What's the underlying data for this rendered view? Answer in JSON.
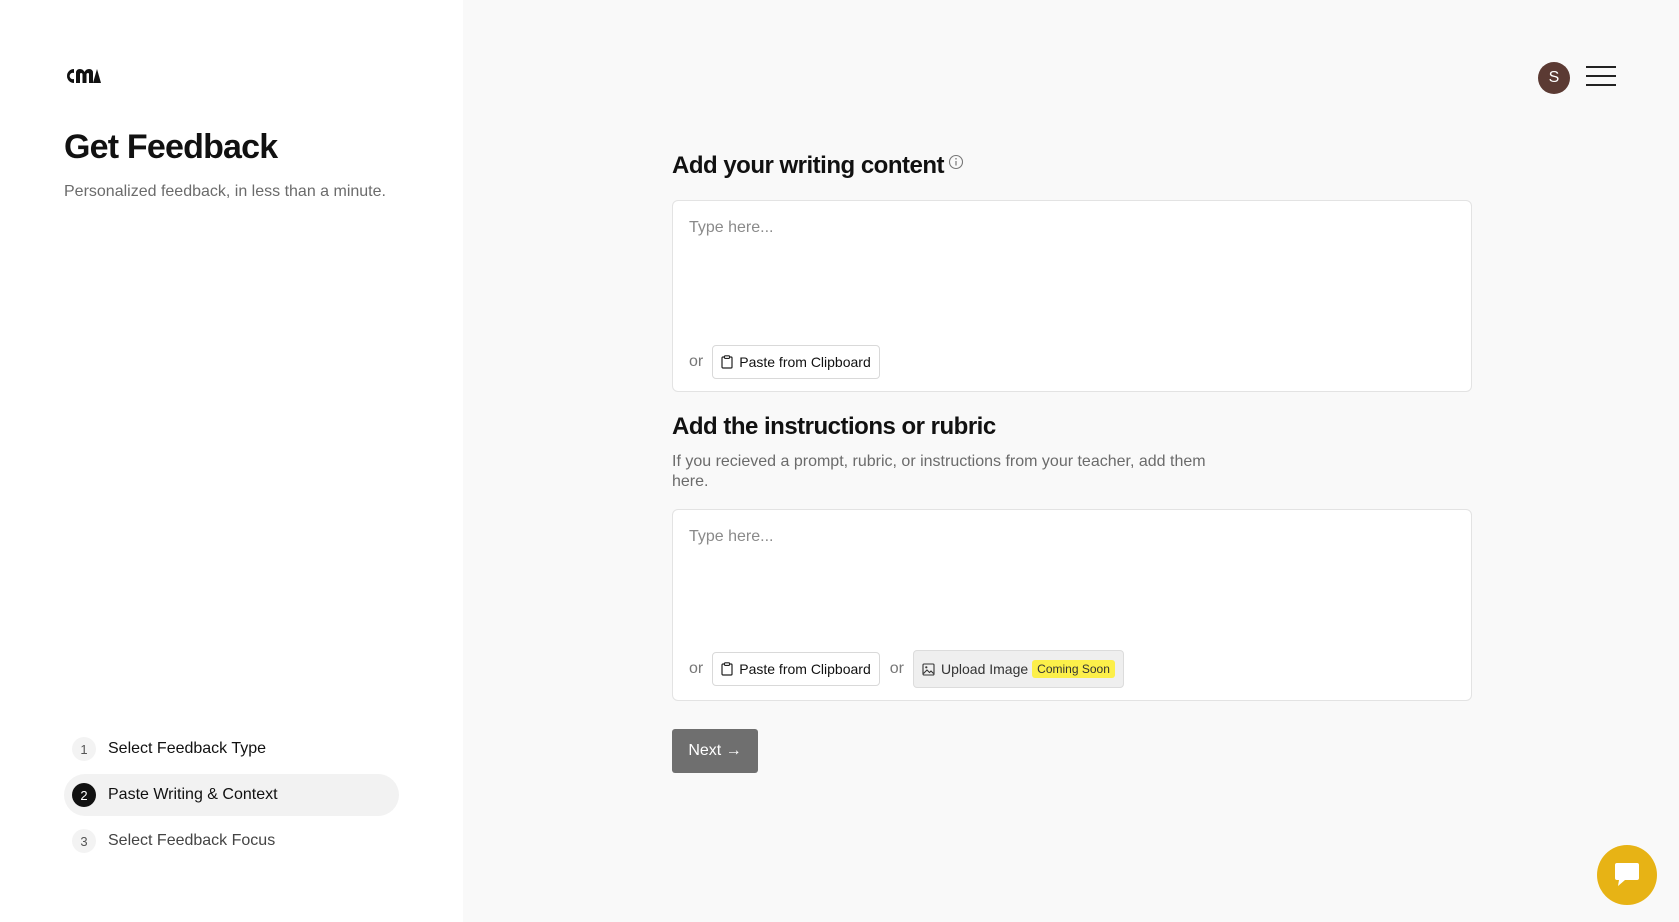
{
  "sidebar": {
    "logo": "CM",
    "title": "Get Feedback",
    "subtitle": "Personalized feedback, in less than a minute.",
    "steps": [
      {
        "num": "1",
        "label": "Select Feedback Type"
      },
      {
        "num": "2",
        "label": "Paste Writing & Context"
      },
      {
        "num": "3",
        "label": "Select Feedback Focus"
      }
    ]
  },
  "header": {
    "avatar_initial": "S",
    "menu_icon": "hamburger-menu-icon"
  },
  "writing": {
    "title": "Add your writing content",
    "placeholder": "Type here...",
    "or_label": "or",
    "paste_label": "Paste from Clipboard"
  },
  "instructions": {
    "title": "Add the instructions or rubric",
    "description": "If you recieved a prompt, rubric, or instructions from your teacher, add them here.",
    "placeholder": "Type here...",
    "or_label": "or",
    "paste_label": "Paste from Clipboard",
    "or_label_2": "or",
    "upload_label": "Upload Image",
    "coming_soon_label": "Coming Soon"
  },
  "next_label": "Next →",
  "colors": {
    "avatar": "#5b3a33",
    "active_step": "#111111",
    "next_button": "#6f6f6f",
    "chat_button": "#e7b315",
    "badge": "#fcef4a"
  }
}
